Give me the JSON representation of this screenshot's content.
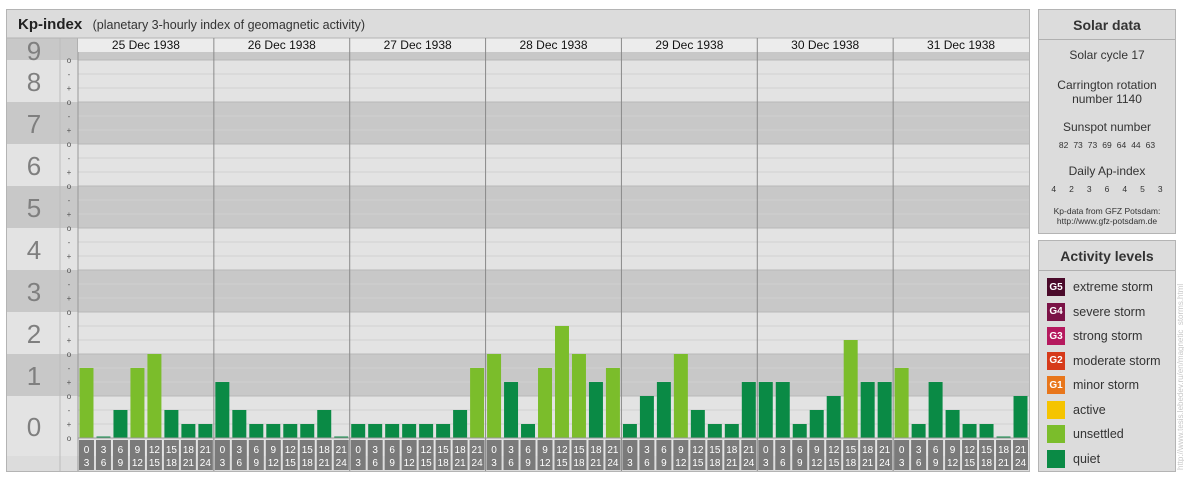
{
  "header": {
    "title": "Kp-index",
    "subtitle": "(planetary 3-hourly index of geomagnetic activity)"
  },
  "colors": {
    "panel_bg": "#dcdcdc",
    "band_dark": "#c8c8c8",
    "band_light": "#e3e3e3",
    "quiet": "#0a8a45",
    "unsettled": "#7bbd2b",
    "slot_bg": "#7a7a7a",
    "big_numeral": "#7f7f7f"
  },
  "chart_data": {
    "type": "bar",
    "ylabel": "",
    "ylim": [
      0,
      9
    ],
    "y_ticks": [
      "0",
      "1",
      "2",
      "3",
      "4",
      "5",
      "6",
      "7",
      "8",
      "9"
    ],
    "y_subticks": [
      "o",
      "+",
      "-"
    ],
    "grid": true,
    "days": [
      "25 Dec 1938",
      "26 Dec 1938",
      "27 Dec 1938",
      "28 Dec 1938",
      "29 Dec 1938",
      "30 Dec 1938",
      "31 Dec 1938"
    ],
    "slots_top": [
      "0",
      "3",
      "6",
      "9",
      "12",
      "15",
      "18",
      "21"
    ],
    "slots_bottom": [
      "3",
      "6",
      "9",
      "12",
      "15",
      "18",
      "21",
      "24"
    ],
    "kp_values": [
      [
        1.667,
        0,
        0.667,
        1.667,
        2,
        0.667,
        0.333,
        0.333
      ],
      [
        1.333,
        0.667,
        0.333,
        0.333,
        0.333,
        0.333,
        0.667,
        0
      ],
      [
        0.333,
        0.333,
        0.333,
        0.333,
        0.333,
        0.333,
        0.667,
        1.667
      ],
      [
        2,
        1.333,
        0.333,
        1.667,
        2.667,
        2,
        1.333,
        1.667
      ],
      [
        0.333,
        1,
        1.333,
        2,
        0.667,
        0.333,
        0.333,
        1.333
      ],
      [
        1.333,
        1.333,
        0.333,
        0.667,
        1,
        2.333,
        1.333,
        1.333
      ],
      [
        1.667,
        0.333,
        1.333,
        0.667,
        0.333,
        0.333,
        0,
        1
      ]
    ]
  },
  "solar": {
    "title": "Solar data",
    "cycle": "Solar cycle 17",
    "carrington_line1": "Carrington rotation",
    "carrington_line2": "number 1140",
    "sunspot_title": "Sunspot number",
    "sunspots": [
      "82",
      "73",
      "73",
      "69",
      "64",
      "44",
      "63"
    ],
    "ap_title": "Daily Ap-index",
    "ap": [
      "4",
      "2",
      "3",
      "6",
      "4",
      "5",
      "3"
    ],
    "credit_line1": "Kp-data from GFZ Potsdam:",
    "credit_line2": "http://www.gfz-potsdam.de"
  },
  "activity": {
    "title": "Activity levels",
    "levels": [
      {
        "code": "G5",
        "label": "extreme storm",
        "color": "#4a0a2a"
      },
      {
        "code": "G4",
        "label": "severe storm",
        "color": "#7a1246"
      },
      {
        "code": "G3",
        "label": "strong storm",
        "color": "#b5195e"
      },
      {
        "code": "G2",
        "label": "moderate storm",
        "color": "#d63a1a"
      },
      {
        "code": "G1",
        "label": "minor storm",
        "color": "#e8761b"
      },
      {
        "code": "",
        "label": "active",
        "color": "#f5c400"
      },
      {
        "code": "",
        "label": "unsettled",
        "color": "#7bbd2b"
      },
      {
        "code": "",
        "label": "quiet",
        "color": "#0a8a45"
      }
    ]
  },
  "watermark": "http://www.tesis.lebedev.ru/en/magnetic_storms.html"
}
